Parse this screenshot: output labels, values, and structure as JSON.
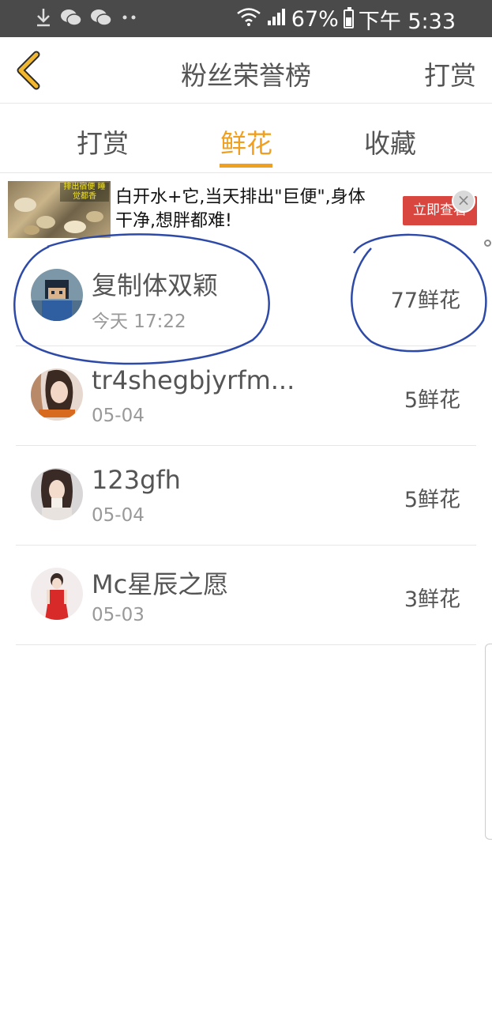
{
  "status_bar": {
    "battery": "67%",
    "time": "下午 5:33",
    "icons": [
      "download-icon",
      "wechat-icon",
      "wechat-icon",
      "more-dots-icon",
      "wifi-icon",
      "signal-icon",
      "battery-icon"
    ]
  },
  "header": {
    "title": "粉丝荣誉榜",
    "right_link": "打赏",
    "back_icon": "chevron-left-icon",
    "accent_color": "#f0a020"
  },
  "tabs": [
    {
      "label": "打赏",
      "active": false
    },
    {
      "label": "鲜花",
      "active": true
    },
    {
      "label": "收藏",
      "active": false
    }
  ],
  "ad": {
    "thumb_text": "排出宿便 睡觉都香",
    "text": "白开水+它,当天排出\"巨便\",身体干净,想胖都难!",
    "button": "立即查看",
    "close_icon": "close-icon"
  },
  "list": [
    {
      "name": "复制体双颖",
      "time": "今天 17:22",
      "count": "77鲜花",
      "avatar": "avatar-cartoon"
    },
    {
      "name": "tr4shegbjyrfm...",
      "time": "05-04",
      "count": "5鲜花",
      "avatar": "avatar-woman"
    },
    {
      "name": "123gfh",
      "time": "05-04",
      "count": "5鲜花",
      "avatar": "avatar-woman-cup"
    },
    {
      "name": "Mc星辰之愿",
      "time": "05-03",
      "count": "3鲜花",
      "avatar": "avatar-woman-red"
    }
  ]
}
